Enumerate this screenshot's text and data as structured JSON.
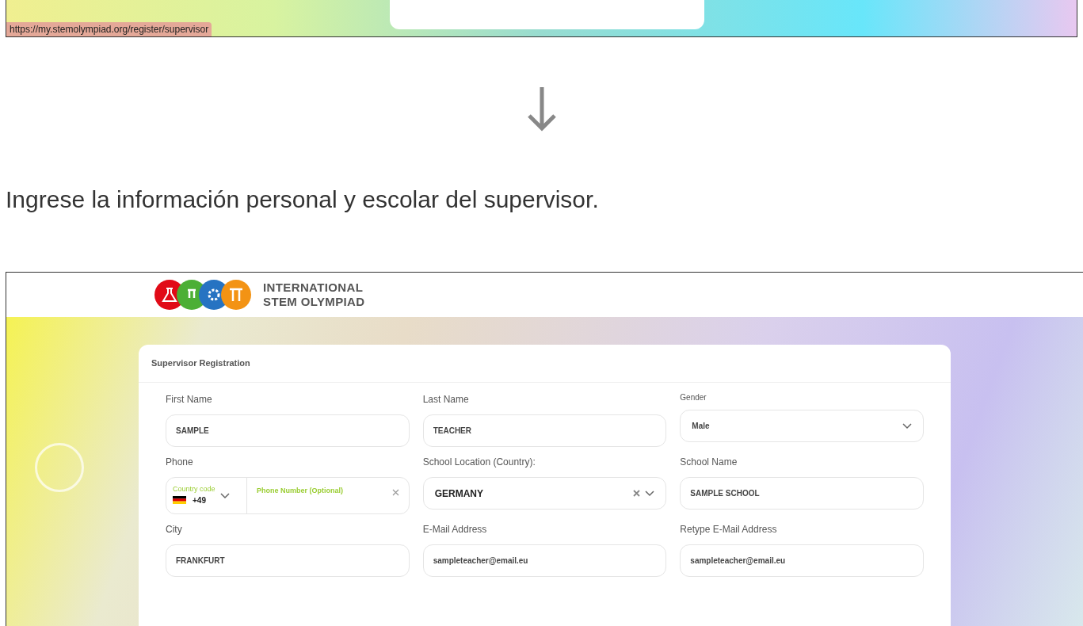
{
  "top_screenshot": {
    "status_url": "https://my.stemolympiad.org/register/supervisor"
  },
  "instruction": "Ingrese la información personal y escolar del supervisor.",
  "screenshot": {
    "logo_lines": [
      "INTERNATIONAL",
      "STEM OLYMPIAD"
    ],
    "card": {
      "title": "Supervisor Registration",
      "fields": [
        {
          "kind": "text",
          "label": "First Name",
          "value": "SAMPLE"
        },
        {
          "kind": "text",
          "label": "Last Name",
          "value": "TEACHER"
        },
        {
          "kind": "select",
          "label": "Gender",
          "value": "Male"
        },
        {
          "kind": "phone",
          "label": "Phone",
          "country_code_label": "Country code",
          "code": "+49",
          "placeholder": "Phone Number (Optional)"
        },
        {
          "kind": "country",
          "label": "School Location (Country):",
          "value": "GERMANY"
        },
        {
          "kind": "text",
          "label": "School Name",
          "value": "SAMPLE SCHOOL"
        },
        {
          "kind": "text",
          "label": "City",
          "value": "FRANKFURT"
        },
        {
          "kind": "text",
          "label": "E-Mail Address",
          "value": "sampleteacher@email.eu"
        },
        {
          "kind": "text",
          "label": "Retype E-Mail Address",
          "value": "sampleteacher@email.eu"
        }
      ]
    }
  }
}
